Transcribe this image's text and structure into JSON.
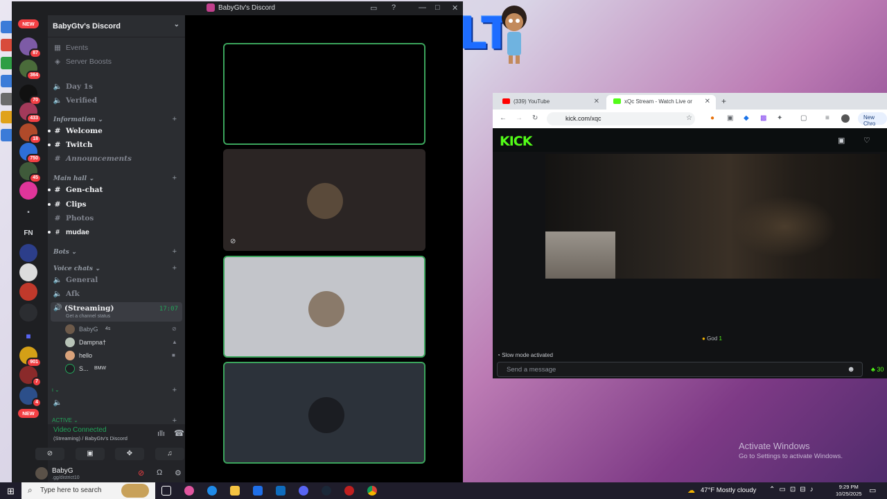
{
  "desktop": {
    "watermark_title": "Activate Windows",
    "watermark_sub": "Go to Settings to activate Windows.",
    "overlay_text": "BELT"
  },
  "discord": {
    "window_title": "BabyGtv's Discord",
    "server_name": "BabyGtv's Discord",
    "server_badges": [
      "NEW",
      "87",
      "364",
      "70",
      "433",
      "18",
      "750",
      "45",
      "FN",
      "901",
      "7",
      "4",
      "NEW"
    ],
    "channels": {
      "events": "Events",
      "boosts": "Server Boosts",
      "day": "Day 1s",
      "verified": "Verified",
      "cat_info": "Information",
      "welcome": "Welcome",
      "twitch": "Twitch",
      "announcements": "Announcements",
      "cat_main": "Main hall",
      "genchat": "Gen-chat",
      "clips": "Clips",
      "photos": "Photos",
      "mudae": "mudae",
      "cat_bots": "Bots",
      "cat_voice": "Voice chats",
      "general": "General",
      "afk": "Afk",
      "streaming": "(Streaming)",
      "status": "Get a channel status",
      "timer": "17:07",
      "active": "ACTIVE"
    },
    "voice_users": [
      {
        "name": "BabyG",
        "extra": "4s"
      },
      {
        "name": "Dampna†",
        "extra": ""
      },
      {
        "name": "hello",
        "extra": ""
      },
      {
        "name": "S...",
        "extra": "BMW"
      }
    ],
    "voice_panel": {
      "title": "Video Connected",
      "sub": "(Streaming) / BabyGtv's Discord"
    },
    "user": {
      "name": "BabyG",
      "tag": ".gg/district10"
    }
  },
  "browser": {
    "tabs": [
      {
        "label": "(339) YouTube"
      },
      {
        "label": "xQc Stream - Watch Live or"
      }
    ],
    "url": "kick.com/xqc",
    "new_chrome": "New Chro",
    "kick_logo": "KICK",
    "god": "God",
    "god_count": "1",
    "slow_mode": "Slow mode activated",
    "msg_placeholder": "Send a message",
    "viewers": "30"
  },
  "taskbar": {
    "search": "Type here to search",
    "weather": "47°F  Mostly cloudy",
    "time": "9:29 PM",
    "date": "10/25/2025"
  },
  "colors": {
    "discord_bg": "#1e1f22",
    "discord_green": "#23a55a",
    "kick_green": "#53fc18",
    "badge_red": "#f23f43"
  }
}
